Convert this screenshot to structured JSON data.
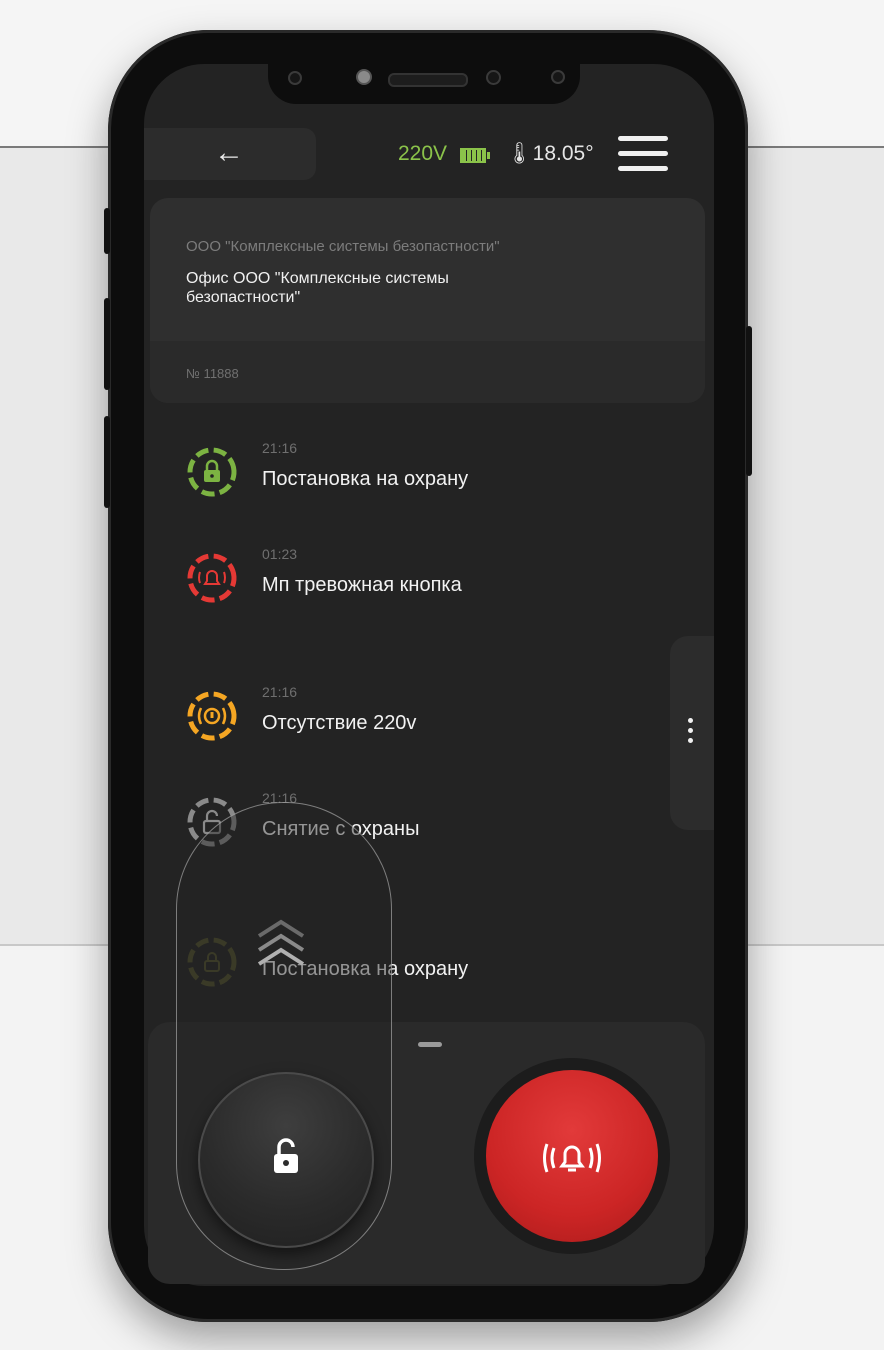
{
  "status_bar": {
    "voltage": "220V",
    "temperature": "🌡18.05°",
    "voltage_color": "#8bc34a"
  },
  "header": {
    "back_icon": "←",
    "menu_icon": "hamburger-menu"
  },
  "object_card": {
    "company": "ООО \"Комплексные системы безопастности\"",
    "object_name": "Офис ООО \"Комплексные системы безопастности\"",
    "number": "№ 11888"
  },
  "events": [
    {
      "time": "21:16",
      "title": "Постановка на охрану",
      "icon": "armed-lock-icon",
      "color": "#7cb342"
    },
    {
      "time": "01:23",
      "title": "Мп тревожная кнопка",
      "icon": "alarm-bell-icon",
      "color": "#e53935"
    },
    {
      "time": "21:16",
      "title": "Отсутствие 220v",
      "icon": "power-warning-icon",
      "color": "#f5a623"
    },
    {
      "time": "21:16",
      "title": "Снятие с охраны",
      "icon": "disarmed-lock-icon",
      "color": "#8a8a8a"
    },
    {
      "time": "",
      "title": "Постановка на охрану",
      "icon": "armed-lock-icon",
      "color": "#4d4d2a"
    }
  ],
  "controls": {
    "disarm_icon": "unlock-icon",
    "alarm_icon": "alarm-bell-icon",
    "alarm_color": "#d32f2f"
  }
}
